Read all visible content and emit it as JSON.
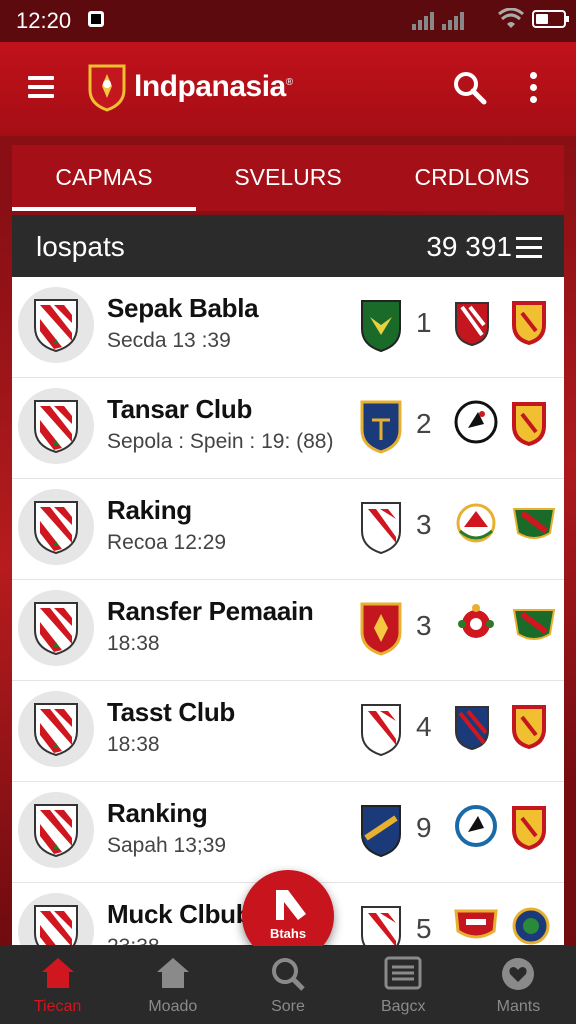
{
  "status": {
    "time": "12:20"
  },
  "app": {
    "title": "lndpanasia",
    "trademark": "®"
  },
  "tabs": [
    {
      "label": "CAPMAS",
      "active": true
    },
    {
      "label": "SVELURS",
      "active": false
    },
    {
      "label": "CRDLOMS",
      "active": false
    }
  ],
  "list_header": {
    "label": "lospats",
    "count": "39 391"
  },
  "rows": [
    {
      "name": "Sepak Babla",
      "sub": "Secda 13 :39",
      "rank": "1"
    },
    {
      "name": "Tansar Club",
      "sub": "Sepola : Spein : 19: (88)",
      "rank": "2"
    },
    {
      "name": "Raking",
      "sub": "Recoa 12:29",
      "rank": "3"
    },
    {
      "name": "Ransfer Pemaain",
      "sub": "18:38",
      "rank": "3"
    },
    {
      "name": "Tasst Club",
      "sub": "18:38",
      "rank": "4"
    },
    {
      "name": "Ranking",
      "sub": "Sapah 13;39",
      "rank": "9"
    },
    {
      "name": "Muck Clbub",
      "sub": "23:38",
      "rank": "5"
    }
  ],
  "fab": {
    "label": "Btahs"
  },
  "bottom_nav": [
    {
      "label": "Tiecan",
      "icon": "home-icon",
      "active": true
    },
    {
      "label": "Moado",
      "icon": "house-icon",
      "active": false
    },
    {
      "label": "Sore",
      "icon": "search-icon",
      "active": false
    },
    {
      "label": "Bagcx",
      "icon": "list-icon",
      "active": false
    },
    {
      "label": "Mants",
      "icon": "heart-icon",
      "active": false
    }
  ],
  "colors": {
    "primary": "#c1121b",
    "dark": "#2b2b2b",
    "accent": "#d0161e"
  }
}
